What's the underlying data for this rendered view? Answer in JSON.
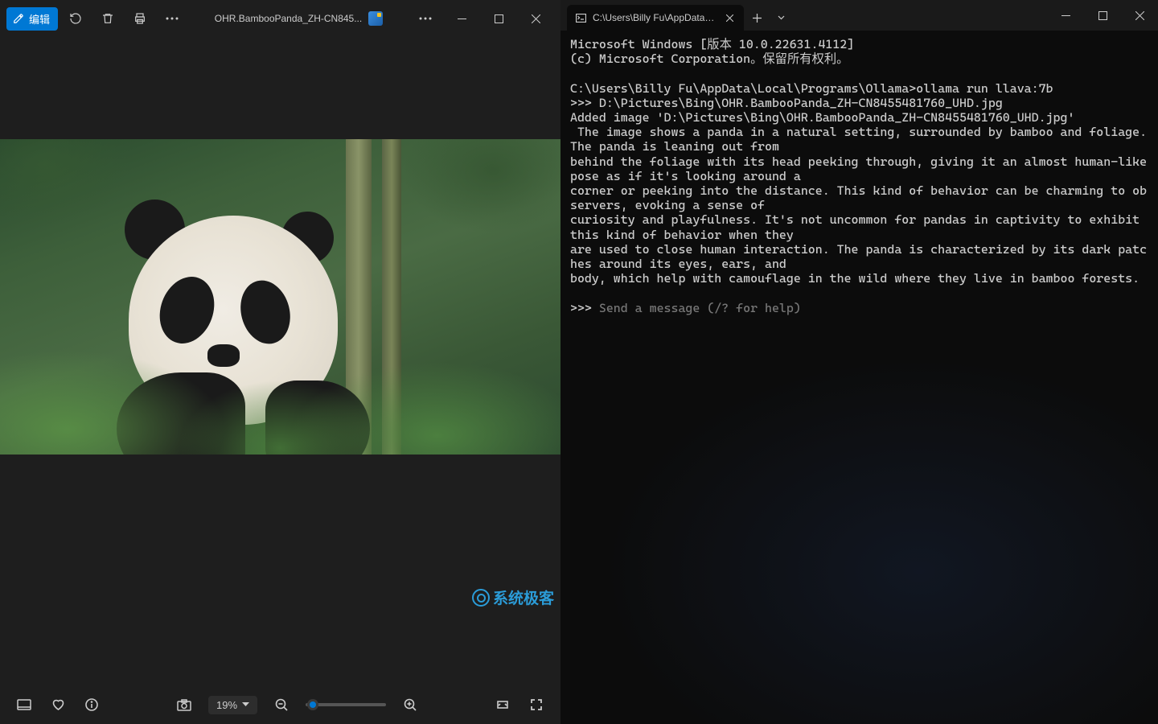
{
  "photos": {
    "edit_label": "编辑",
    "title": "OHR.BambooPanda_ZH-CN845...",
    "zoom_text": "19%",
    "watermark": "系统极客",
    "image_alt": "Panda in bamboo foliage"
  },
  "terminal": {
    "tab_title": "C:\\Users\\Billy Fu\\AppData\\Lo",
    "lines": [
      "Microsoft Windows [版本 10.0.22631.4112]",
      "(c) Microsoft Corporation。保留所有权利。",
      "",
      "C:\\Users\\Billy Fu\\AppData\\Local\\Programs\\Ollama>ollama run llava:7b",
      ">>> D:\\Pictures\\Bing\\OHR.BambooPanda_ZH-CN8455481760_UHD.jpg",
      "Added image 'D:\\Pictures\\Bing\\OHR.BambooPanda_ZH-CN8455481760_UHD.jpg'",
      " The image shows a panda in a natural setting, surrounded by bamboo and foliage. The panda is leaning out from",
      "behind the foliage with its head peeking through, giving it an almost human-like pose as if it's looking around a",
      "corner or peeking into the distance. This kind of behavior can be charming to observers, evoking a sense of",
      "curiosity and playfulness. It's not uncommon for pandas in captivity to exhibit this kind of behavior when they",
      "are used to close human interaction. The panda is characterized by its dark patches around its eyes, ears, and",
      "body, which help with camouflage in the wild where they live in bamboo forests.",
      ""
    ],
    "prompt": ">>> ",
    "placeholder": "Send a message (/? for help)"
  }
}
